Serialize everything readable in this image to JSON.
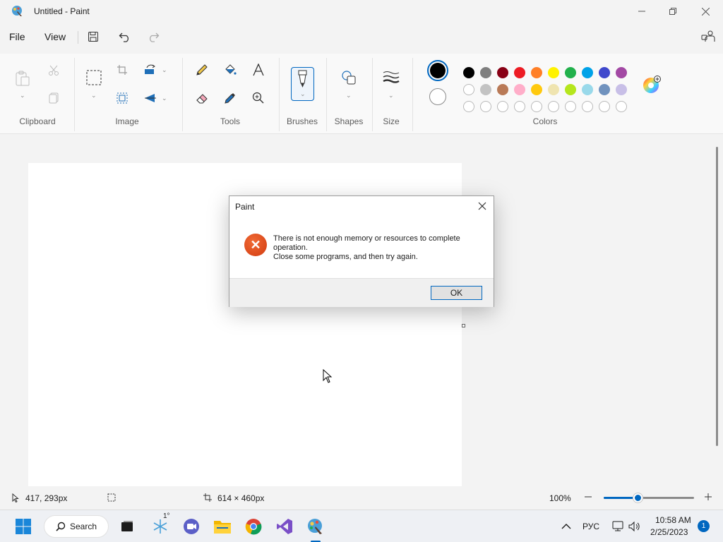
{
  "window": {
    "title": "Untitled - Paint",
    "app_icon": "paint-app-icon",
    "controls": [
      "minimize-icon",
      "maximize-icon",
      "close-icon"
    ]
  },
  "menu": {
    "file": "File",
    "view": "View",
    "quick_actions": [
      "save-icon",
      "undo-icon",
      "redo-icon"
    ]
  },
  "ribbon": {
    "groups": {
      "clipboard": "Clipboard",
      "image": "Image",
      "tools": "Tools",
      "brushes": "Brushes",
      "shapes": "Shapes",
      "size": "Size",
      "colors": "Colors"
    },
    "primary_color": "#000000",
    "secondary_color": "#ffffff",
    "palette_row1": [
      "#000000",
      "#7f7f7f",
      "#880015",
      "#ed1c24",
      "#ff7f27",
      "#fff200",
      "#22b14c",
      "#00a2e8",
      "#3f48cc",
      "#a349a4"
    ],
    "palette_row2": [
      "#ffffff",
      "#c3c3c3",
      "#b97a57",
      "#ffaec9",
      "#ffc90e",
      "#efe4b0",
      "#b5e61d",
      "#99d9ea",
      "#7092be",
      "#c8bfe7"
    ]
  },
  "dialog": {
    "title": "Paint",
    "message_line1": "There is not enough memory or resources to complete",
    "message_line2": "operation.",
    "message_line3": "Close some programs, and then try again.",
    "ok": "OK",
    "icon": "error-icon"
  },
  "status": {
    "cursor_position": "417, 293px",
    "canvas_size": "614 × 460px",
    "zoom": "100%",
    "zoom_level": 0.375
  },
  "taskbar": {
    "search": "Search",
    "weather_temp": "1°",
    "language": "РУС",
    "time": "10:58 AM",
    "date": "2/25/2023",
    "notifications": "1"
  }
}
